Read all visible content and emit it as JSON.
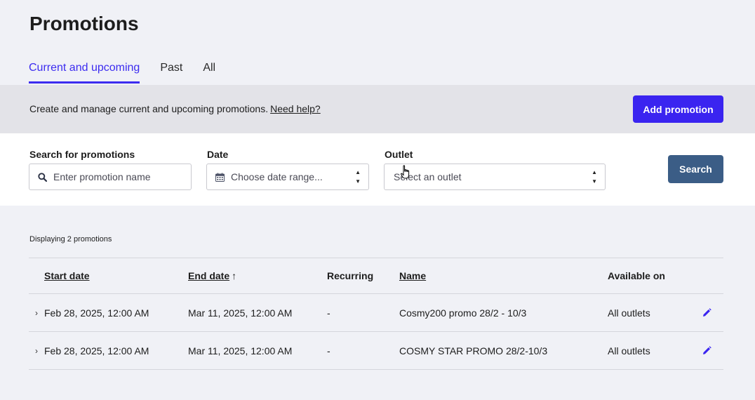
{
  "page": {
    "title": "Promotions"
  },
  "tabs": [
    {
      "label": "Current and upcoming",
      "active": true
    },
    {
      "label": "Past",
      "active": false
    },
    {
      "label": "All",
      "active": false
    }
  ],
  "info_bar": {
    "text": "Create and manage current and upcoming promotions.",
    "help_link": "Need help?",
    "add_button": "Add promotion"
  },
  "filters": {
    "search": {
      "label": "Search for promotions",
      "placeholder": "Enter promotion name",
      "icon": "search-icon"
    },
    "date": {
      "label": "Date",
      "placeholder": "Choose date range...",
      "icon": "calendar-icon"
    },
    "outlet": {
      "label": "Outlet",
      "placeholder": "Select an outlet"
    },
    "search_button": "Search"
  },
  "results": {
    "count_text": "Displaying 2 promotions",
    "columns": {
      "start_date": "Start date",
      "end_date": "End date",
      "sort_indicator": "↑",
      "recurring": "Recurring",
      "name": "Name",
      "available_on": "Available on"
    },
    "rows": [
      {
        "start": "Feb 28, 2025, 12:00 AM",
        "end": "Mar 11, 2025, 12:00 AM",
        "recurring": "-",
        "name": "Cosmy200 promo 28/2 - 10/3",
        "available": "All outlets"
      },
      {
        "start": "Feb 28, 2025, 12:00 AM",
        "end": "Mar 11, 2025, 12:00 AM",
        "recurring": "-",
        "name": "COSMY STAR PROMO 28/2-10/3",
        "available": "All outlets"
      }
    ]
  },
  "colors": {
    "accent": "#3a24f0",
    "search_button": "#3b5d86",
    "background": "#f0f1f6",
    "info_bar": "#e3e3e8"
  }
}
